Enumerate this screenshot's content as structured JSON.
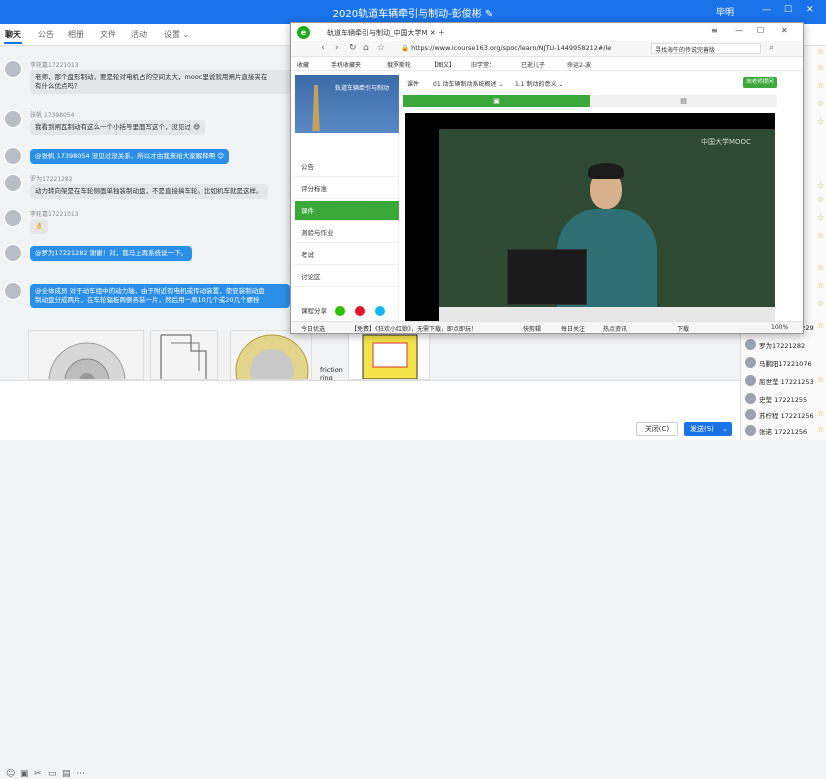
{
  "window": {
    "title": "2020轨道车辆牵引与制动-彭俊彬",
    "edit_icon": "pencil-icon",
    "user": "毕明",
    "controls": [
      "—",
      "☐",
      "✕"
    ]
  },
  "tabs": [
    {
      "label": "聊天",
      "active": true
    },
    {
      "label": "公告"
    },
    {
      "label": "相册"
    },
    {
      "label": "文件"
    },
    {
      "label": "活动"
    },
    {
      "label": "设置"
    }
  ],
  "messages": [
    {
      "sender": "李轮嘉17221013",
      "lines": [
        "老师，那个盘形制动，要是轮对电机占的空间太大，mooc里说就用闸片直接夹在",
        "有什么优点吗？"
      ],
      "style": "gray"
    },
    {
      "sender": "张帆 17398054",
      "lines": [
        "我看到闸瓦制动有这么一个小括号里面写这个，没见过"
      ],
      "style": "gray"
    },
    {
      "sender": "",
      "lines": [
        "@张帆 17398054 没见过没关系，所以才由我来给大家解释啊"
      ],
      "style": "blue"
    },
    {
      "sender": "罗为17221282",
      "lines": [
        "动力转向架是在车轮侧面单独装制动盘，不是直接搞车轮。比如机车就是这样。"
      ],
      "style": "gray"
    },
    {
      "sender": "李轮嘉17221013",
      "lines": [
        "👌"
      ],
      "style": "gray"
    },
    {
      "sender": "",
      "lines": [
        "@罗为17221282 谢谢！对，我马上再系统说一下。"
      ],
      "style": "blue"
    },
    {
      "sender": "",
      "lines": [
        "@全体成员 对于动车组中的动力轴，由于附近有电机或传动装置，使安装制动盘",
        "制动盘分成两片，在车轮辐板两侧各装一片，然后用一周10几个或20几个螺栓"
      ],
      "style": "blue"
    }
  ],
  "chat_image_label": [
    "friction",
    "ring"
  ],
  "input": {
    "close_label": "关闭(C)",
    "send_label": "发送(S)",
    "send_arrow": "⌄"
  },
  "members": [
    {
      "name": "刘萍伟 17221229",
      "star": true
    },
    {
      "name": "罗为17221282",
      "star": false
    },
    {
      "name": "马鹏阳17221076",
      "star": false
    },
    {
      "name": "屈世莹 17221253",
      "star": true
    },
    {
      "name": "史莹 17221255",
      "star": false
    },
    {
      "name": "苏柠程 17221256",
      "star": true
    },
    {
      "name": "张诺 17221256",
      "star": true
    }
  ],
  "browser": {
    "tab_title": "轨道车辆牵引与制动_中国大学M",
    "url": "https://www.icourse163.org/spoc/learn/NJTU-1449958212#/le",
    "search": "寻找海牛的传说完善版",
    "bookmarks": [
      "收藏",
      "手机收藏夹",
      "俄罗斯轮",
      "【图文】",
      "旧学堂：",
      "已逝儿子",
      "命运2-波"
    ],
    "course_title": "轨道车辆牵引与制动",
    "menu": [
      {
        "label": "公告"
      },
      {
        "label": "评分标准"
      },
      {
        "label": "课件",
        "active": true
      },
      {
        "label": "测验与作业"
      },
      {
        "label": "考试"
      },
      {
        "label": "讨论区"
      }
    ],
    "share_label": "课程分享",
    "crumb_1": "课件",
    "crumb_2": "01 动车辆制动系统概述",
    "crumb_3": "1.1 制动的意义",
    "ask_label": "向老师提问",
    "video_watermark": "中国大学MOOC",
    "status": [
      "今日优选",
      "【免费】《狂欢小红娘》，无需下载，即点即玩！",
      "快剪辑",
      "每日关注",
      "热点资讯",
      "下载",
      "100%"
    ]
  },
  "colors": {
    "accent": "#1a73e8",
    "course_green": "#3aa93a",
    "bubble_blue": "#2b8fe8"
  }
}
